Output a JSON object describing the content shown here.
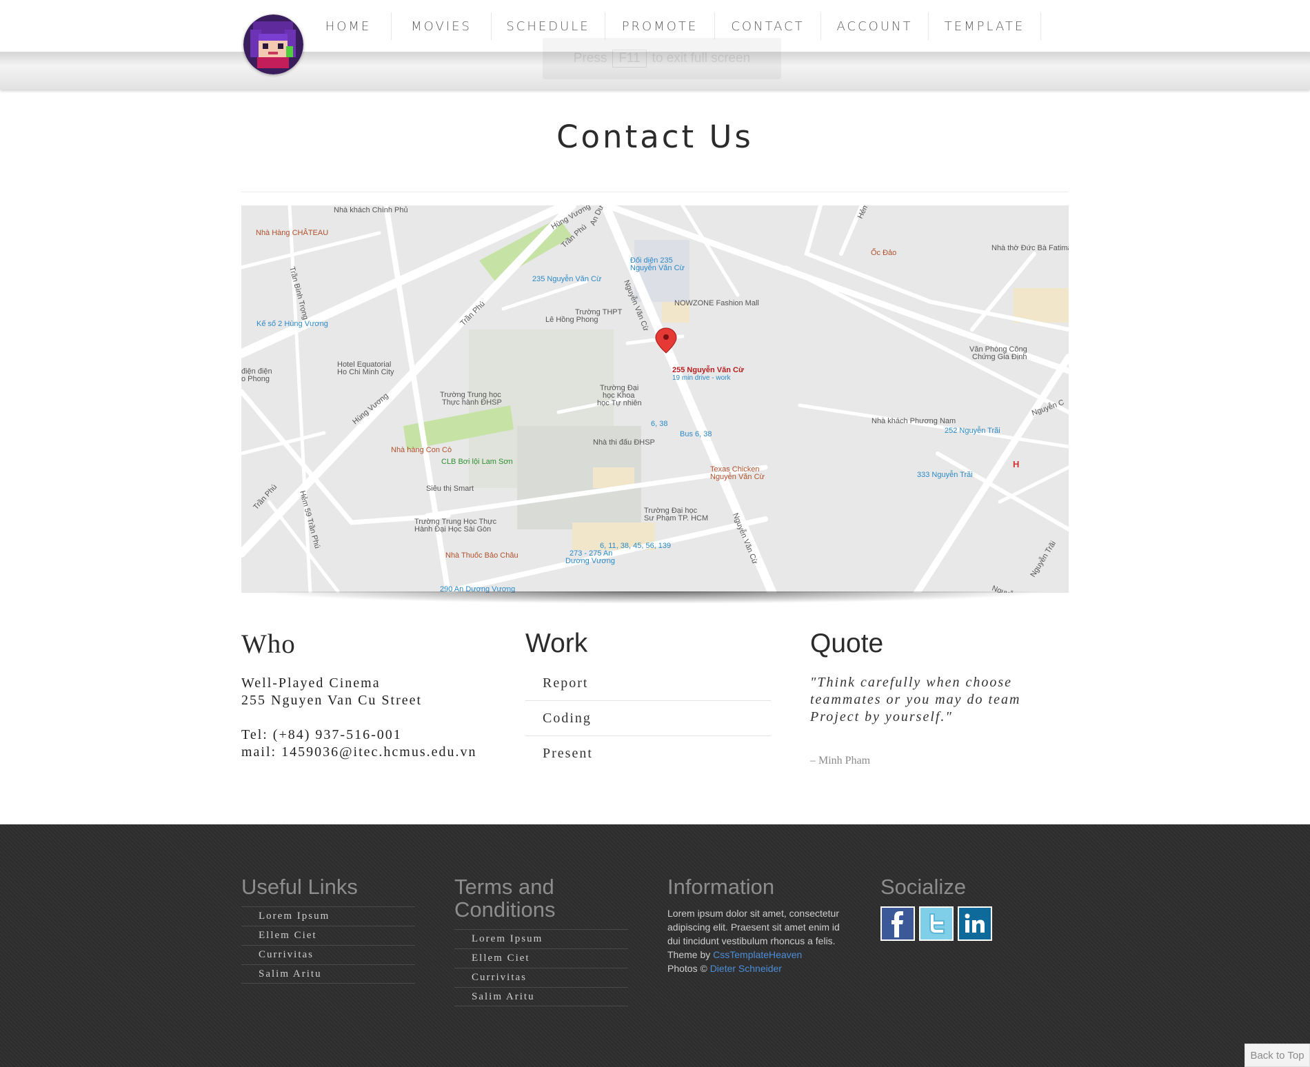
{
  "nav": {
    "items": [
      {
        "label": "HOME"
      },
      {
        "label": "MOVIES"
      },
      {
        "label": "SCHEDULE"
      },
      {
        "label": "PROMOTE"
      },
      {
        "label": "CONTACT"
      },
      {
        "label": "ACCOUNT"
      },
      {
        "label": "TEMPLATE"
      }
    ]
  },
  "fullscreen_hint": {
    "before": "Press",
    "key": "F11",
    "after": "to exit full screen"
  },
  "page": {
    "title": "Contact Us"
  },
  "map": {
    "marker": {
      "title": "255 Nguyễn Văn Cừ",
      "subtitle": "19 min drive - work"
    },
    "labels": {
      "nha_khach_chinh_phu": "Nhà khách Chính Phủ",
      "nha_hang_chateau": "Nhà Hàng CHÂTEAU",
      "hung_vuong_1": "Hùng Vương",
      "tran_phu_1": "Trần Phú",
      "tran_phu_2": "Trần Phú",
      "tran_phu_3": "Trần Phú",
      "tran_binh_trong": "Trần Bình Trọng",
      "ke_so_2": "Kế số 2 Hùng Vương",
      "dien_phong": "Điện điện\no Phong",
      "hotel_equatorial": "Hotel Equatorial\nHo Chi Minh City",
      "truong_th_dhsp": "Trường Trung học\nThực hành ĐHSP",
      "hung_vuong_2": "Hùng Vương",
      "nha_hang_con_co": "Nhà hàng Con Cò",
      "clb_boi_loi": "CLB Bơi lội Lam Sơn",
      "sieu_thi_smart": "Siêu thị Smart",
      "hem_59": "Hẻm 59 Trần Phú",
      "truong_th_sai_gon": "Trường Trung Học Thực\nHành Đại Học Sài Gòn",
      "nha_thuoc": "Nhà Thuốc Bảo Châu",
      "bus_290": "290 An Dương Vương",
      "bus_273": "273 - 275 An\nDương Vương",
      "bus_6_11": "6, 11, 38, 45, 56, 139",
      "truong_dhsp": "Trường Đại học\nSư Phạm TP. HCM",
      "nha_thi_dau": "Nhà thi đấu ĐHSP",
      "bus_6_38_a": "6, 38",
      "bus_6_38_b": "Bus 6, 38",
      "texas": "Texas Chicken\nNguyễn Văn Cừ",
      "truong_dh_khtn": "Trường Đại\nhọc Khoa\nhọc Tự nhiên",
      "truong_le_hong_phong": "Trường THPT\nLê Hồng Phong",
      "bus_235": "235 Nguyễn Văn Cừ",
      "doi_dien_235": "Đối diện 235\nNguyễn Văn Cừ",
      "nowzone": "NOWZONE Fashion Mall",
      "nvc_1": "Nguyễn Văn Cừ",
      "nvc_2": "Nguyễn Văn Cừ",
      "an_duong_vuong_top": "An Dương",
      "oc_dao": "Ốc Đảo",
      "nha_tho": "Nhà thờ Đức Bà Fatima",
      "van_phong": "Văn Phòng Công\nChứng Gia Định",
      "nha_khach_pn": "Nhà khách Phương Nam",
      "bus_252": "252 Nguyễn Trãi",
      "bus_333": "333 Nguyễn Trãi",
      "nguyen_trai_1": "Nguyễn Trãi",
      "nguyen_trai_2": "Nguyễn",
      "nguyen_c": "Nguyễn C",
      "hem": "Hẻm"
    }
  },
  "who": {
    "heading": "Who",
    "name": "Well-Played Cinema",
    "address": "255 Nguyen Van Cu Street",
    "tel": "Tel: (+84) 937-516-001",
    "mail": "mail: 1459036@itec.hcmus.edu.vn"
  },
  "work": {
    "heading": "Work",
    "items": [
      {
        "label": "Report"
      },
      {
        "label": "Coding"
      },
      {
        "label": "Present"
      }
    ]
  },
  "quote": {
    "heading": "Quote",
    "text": "\"Think carefully when choose teammates or you may do team Project by yourself.\"",
    "author": "– Minh Pham"
  },
  "footer": {
    "useful_links": {
      "heading": "Useful Links",
      "items": [
        {
          "label": "Lorem Ipsum"
        },
        {
          "label": "Ellem Ciet"
        },
        {
          "label": "Currivitas"
        },
        {
          "label": "Salim Aritu"
        }
      ]
    },
    "terms": {
      "heading": "Terms and Conditions",
      "items": [
        {
          "label": "Lorem Ipsum"
        },
        {
          "label": "Ellem Ciet"
        },
        {
          "label": "Currivitas"
        },
        {
          "label": "Salim Aritu"
        }
      ]
    },
    "information": {
      "heading": "Information",
      "text": "Lorem ipsum dolor sit amet, consectetur adipiscing elit. Praesent sit amet enim id dui tincidunt vestibulum rhoncus a felis.",
      "theme_prefix": "Theme by",
      "theme_link": "CssTemplateHeaven",
      "photos_prefix": "Photos ©",
      "photos_link": "Dieter Schneider"
    },
    "socialize": {
      "heading": "Socialize",
      "icons": [
        "facebook-icon",
        "twitter-icon",
        "linkedin-icon"
      ],
      "colors": {
        "facebook": "#3b5998",
        "twitter": "#7fcfe9",
        "linkedin": "#0e6a9a"
      }
    },
    "back_to_top": "Back to Top"
  },
  "colors": {
    "footer_bg": "#2e2e2e",
    "link": "#4d8ed8",
    "marker": "#e53935",
    "park": "#c6e3a5"
  }
}
